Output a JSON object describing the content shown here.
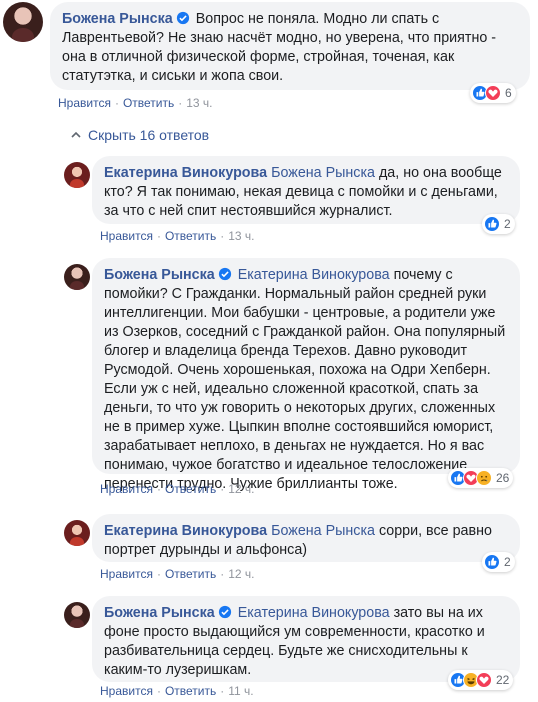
{
  "comments": [
    {
      "author": "Божена Рынска",
      "verified": true,
      "mention": "",
      "lines": [
        "Вопрос не поняла. Модно ли спать с",
        "Лаврентьевой? Не знаю насчёт модно, но уверена, что приятно -",
        "она в отличной физической форме, стройная, точеная, как",
        "статутэтка, и сиськи и жопа свои."
      ],
      "like_label": "Нравится",
      "reply_label": "Ответить",
      "time": "13 ч.",
      "reactions": [
        "like",
        "love"
      ],
      "reaction_count": "6"
    },
    {
      "author": "Екатерина Винокурова",
      "verified": false,
      "mention": "Божена Рынска",
      "lines": [
        "да, но она вообще",
        "кто? Я так понимаю, некая девица с помойки и с деньгами,",
        "за что с ней спит нестоявшийся журналист."
      ],
      "like_label": "Нравится",
      "reply_label": "Ответить",
      "time": "13 ч.",
      "reactions": [
        "like"
      ],
      "reaction_count": "2"
    },
    {
      "author": "Божена Рынска",
      "verified": true,
      "mention": "Екатерина Винокурова",
      "lines": [
        "почему с",
        "помойки? С Гражданки. Нормальный район средней руки",
        "интеллигенции. Мои бабушки - центровые, а родители уже",
        "из Озерков, соседний с Гражданкой район. Она популярный",
        "блогер и владелица бренда Терехов. Давно руководит",
        "Русмодой. Очень хорошенькая, похожа на Одри Хепберн.",
        "Если уж с ней, идеально сложенной красоткой, спать за",
        "деньги, то что уж говорить о некоторых других, сложенных",
        "не в пример хуже. Цыпкин вполне состоявшийся юморист,",
        "зарабатывает неплохо, в деньгах не нуждается. Но я вас",
        "понимаю, чужое богатство и идеальное телосложение",
        "перенести трудно. Чужие бриллианты тоже."
      ],
      "like_label": "Нравится",
      "reply_label": "Ответить",
      "time": "12 ч.",
      "reactions": [
        "like",
        "love",
        "sad"
      ],
      "reaction_count": "26"
    },
    {
      "author": "Екатерина Винокурова",
      "verified": false,
      "mention": "Божена Рынска",
      "lines": [
        "сорри, все равно",
        "портрет дурынды и альфонса)"
      ],
      "like_label": "Нравится",
      "reply_label": "Ответить",
      "time": "12 ч.",
      "reactions": [
        "like"
      ],
      "reaction_count": "2"
    },
    {
      "author": "Божена Рынска",
      "verified": true,
      "mention": "Екатерина Винокурова",
      "lines": [
        "зато вы на их",
        "фоне просто выдающийся ум современности, красотко и",
        "разбивательница сердец. Будьте же снисходительны к",
        "каким-то лузеришкам."
      ],
      "like_label": "Нравится",
      "reply_label": "Ответить",
      "time": "11 ч.",
      "reactions": [
        "like",
        "haha",
        "love"
      ],
      "reaction_count": "22"
    }
  ],
  "hide_replies_label": "Скрыть 16 ответов",
  "colors": {
    "link": "#385898",
    "bubble": "#f2f3f5",
    "like": "#1877f2",
    "love": "#f33e58",
    "haha": "#f7b125",
    "sad": "#f7b125"
  }
}
